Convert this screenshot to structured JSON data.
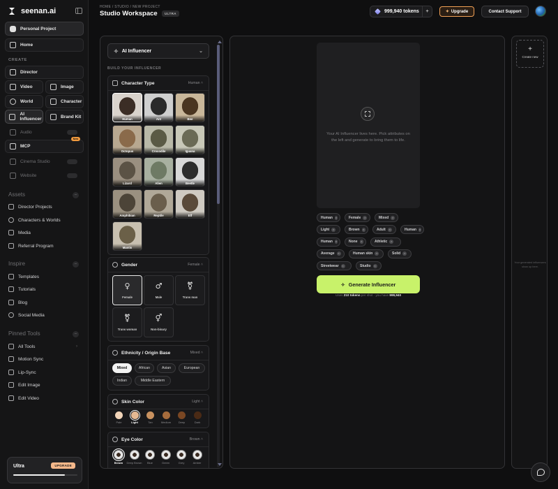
{
  "brand": {
    "name": "seenan.ai"
  },
  "sidebar": {
    "workspace": "Personal Project",
    "home": "Home",
    "create_title": "CREATE",
    "director": "Director",
    "video": "Video",
    "image": "Image",
    "world": "World",
    "character": "Character",
    "ai_influencer": "AI Influencer",
    "brand_kit": "Brand Kit",
    "audio": "Audio",
    "mcp": "MCP",
    "mcp_badge": "New",
    "cinema_studio": "Cinema Studio",
    "website": "Website",
    "assets_title": "Assets",
    "assets": [
      "Director Projects",
      "Characters & Worlds",
      "Media",
      "Referral Program"
    ],
    "inspire_title": "Inspire",
    "inspire": [
      "Templates",
      "Tutorials",
      "Blog",
      "Social Media"
    ],
    "pinned_title": "Pinned Tools",
    "pinned": [
      "All Tools",
      "Motion Sync",
      "Lip-Sync",
      "Edit Image",
      "Edit Video"
    ],
    "plan": {
      "name": "Ultra",
      "upgrade": "UPGRADE",
      "usage_fraction": 0.8
    }
  },
  "header": {
    "breadcrumb": "HOME / STUDIO / NEW PROJECT",
    "title": "Studio Workspace",
    "tier_badge": "ULTRA",
    "tokens": "999,940 tokens",
    "upgrade": "Upgrade",
    "support": "Contact Support"
  },
  "builder": {
    "mode": "AI Influencer",
    "build_label": "BUILD YOUR INFLUENCER",
    "character_type": {
      "title": "Character Type",
      "value": "Human",
      "options": [
        "Human",
        "Ant",
        "Bee",
        "Octopus",
        "Crocodile",
        "Iguana",
        "Lizard",
        "Alien",
        "Beetle",
        "Amphibian",
        "Reptile",
        "Elf",
        "Mantis"
      ],
      "selected": "Human"
    },
    "gender": {
      "title": "Gender",
      "value": "Female",
      "options": [
        "Female",
        "Male",
        "Trans man",
        "Trans woman",
        "Non-binary"
      ],
      "symbols": [
        "♀",
        "♂",
        "⚧",
        "⚧",
        "⚥"
      ],
      "selected": "Female"
    },
    "ethnicity": {
      "title": "Ethnicity / Origin Base",
      "value": "Mixed",
      "options": [
        "Mixed",
        "African",
        "Asian",
        "European",
        "Indian",
        "Middle Eastern"
      ],
      "selected": "Mixed"
    },
    "skin": {
      "title": "Skin Color",
      "value": "Light",
      "options": [
        "Pale",
        "Light",
        "Tan",
        "Medium",
        "Deep",
        "Dark"
      ],
      "colors": [
        "#f0d3b8",
        "#e6b993",
        "#c8915f",
        "#a56b3c",
        "#7a4723",
        "#4a2a15"
      ],
      "selected": "Light"
    },
    "eye": {
      "title": "Eye Color",
      "value": "Brown",
      "options": [
        "Brown",
        "Deep Brown",
        "Blue",
        "Green",
        "Grey",
        "Amber"
      ],
      "selected": "Brown"
    }
  },
  "preview": {
    "empty_text": "Your AI Influencer lives here. Pick attributes on the left and generate to bring them to life.",
    "tags": [
      [
        "Human",
        "Female",
        "Mixed"
      ],
      [
        "Light",
        "Brown",
        "Adult",
        "Human"
      ],
      [
        "Human",
        "None",
        "Athletic"
      ],
      [
        "Average",
        "Human skin",
        "Solid"
      ],
      [
        "Streetwear",
        "Studio"
      ]
    ],
    "generate": "Generate Influencer",
    "cost_prefix": "Uses",
    "cost_tokens": "210 tokens",
    "cost_mid": "per shot · you have",
    "cost_balance": "999,940"
  },
  "gallery": {
    "create_new": "Create new",
    "empty_text": "Your generated influencers show up here."
  },
  "colors": {
    "accent": "#c8f26a",
    "upgrade": "#f1a055"
  }
}
